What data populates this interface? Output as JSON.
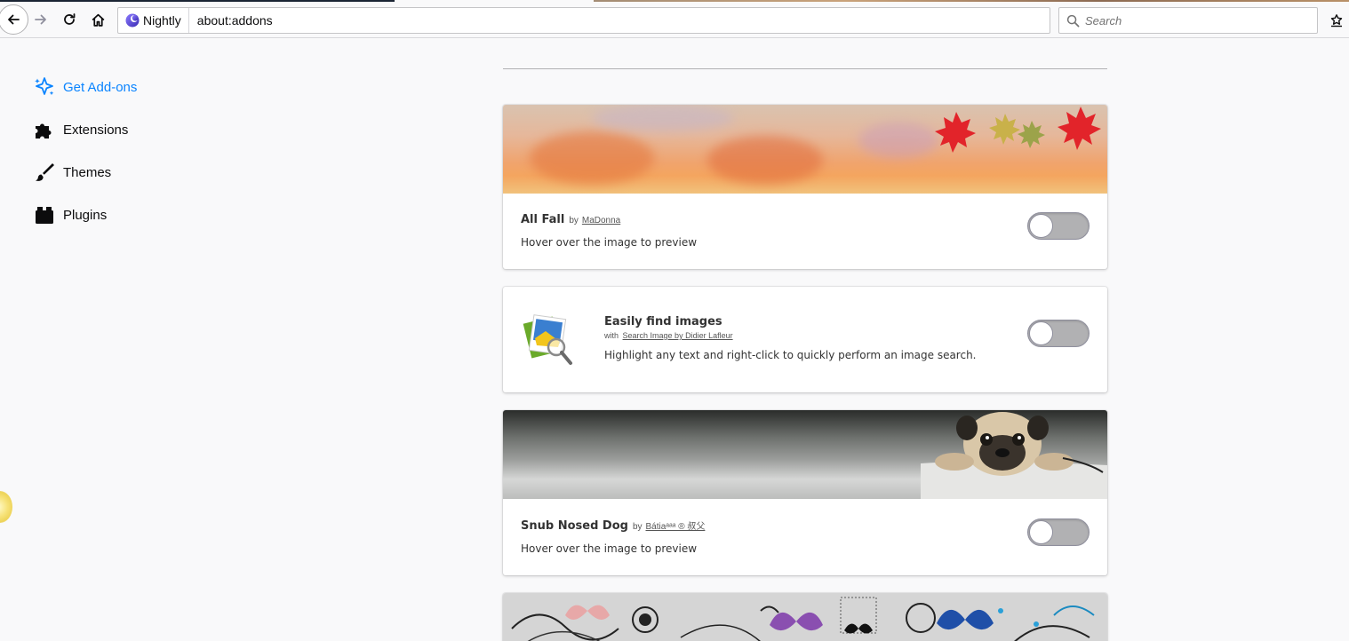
{
  "browser": {
    "identity_label": "Nightly",
    "url": "about:addons",
    "search_placeholder": "Search"
  },
  "sidebar": {
    "items": [
      {
        "label": "Get Add-ons",
        "icon": "sparkle-icon",
        "active": true
      },
      {
        "label": "Extensions",
        "icon": "puzzle-icon",
        "active": false
      },
      {
        "label": "Themes",
        "icon": "brush-icon",
        "active": false
      },
      {
        "label": "Plugins",
        "icon": "plugin-block-icon",
        "active": false
      }
    ]
  },
  "addons": [
    {
      "name": "All Fall",
      "by_label": "by",
      "creator": "MaDonna",
      "description": "Hover over the image to preview",
      "type": "theme",
      "enabled": false
    },
    {
      "name": "Easily find images",
      "by_label": "with",
      "creator": "Search Image by Didier Lafleur",
      "description": "Highlight any text and right-click to quickly perform an image search.",
      "type": "extension",
      "enabled": false
    },
    {
      "name": "Snub Nosed Dog",
      "by_label": "by",
      "creator": "Bátiaᵃᵃᵃ ® 叔父",
      "description": "Hover over the image to preview",
      "type": "theme",
      "enabled": false
    },
    {
      "name": "",
      "type": "theme"
    }
  ],
  "colors": {
    "accent": "#0a84ff",
    "toggle_off": "#b1b1b3"
  }
}
